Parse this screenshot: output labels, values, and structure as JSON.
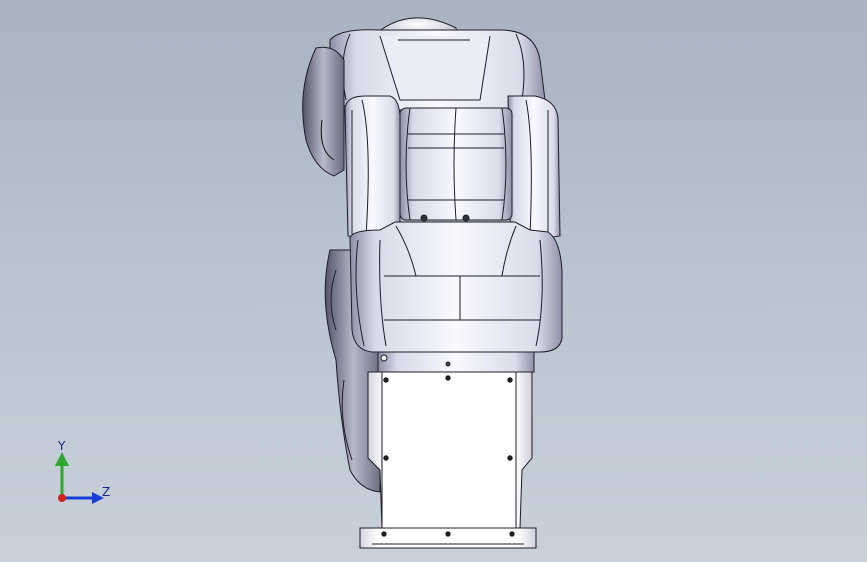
{
  "viewport": {
    "background_top": "#a9b3c1",
    "background_bottom": "#c9d0da"
  },
  "model": {
    "description_icon": "robot-arm-model",
    "edge_color": "#1e1e28",
    "body_color": "#eeeef6",
    "shade_color": "#9a9ab0"
  },
  "triad": {
    "y_label": "Y",
    "z_label": "Z",
    "y_color": "#2ea82e",
    "z_color": "#1a3fd6",
    "x_color": "#d02020"
  }
}
